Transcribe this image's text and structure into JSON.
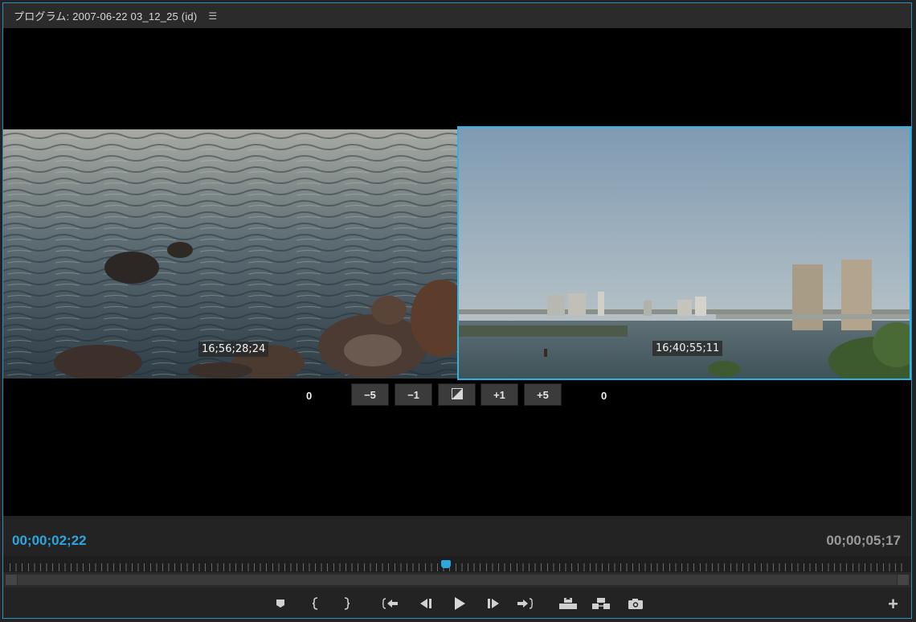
{
  "panel": {
    "title": "プログラム: 2007-06-22 03_12_25 (id)",
    "menu_icon": "hamburger-menu-icon"
  },
  "trim": {
    "left_clip_timecode": "16;56;28;24",
    "right_clip_timecode": "16;40;55;11",
    "left_offset": "0",
    "right_offset": "0",
    "buttons": [
      "−5",
      "−1",
      "",
      "+1",
      "+5"
    ],
    "center_icon": "trim-mode-icon"
  },
  "timebar": {
    "current_timecode": "00;00;02;22",
    "duration_timecode": "00;00;05;17"
  },
  "playhead_fraction": 0.487,
  "colors": {
    "accent": "#2aa6e0",
    "panel_border": "#2d8fc6",
    "selection": "#2fb1e6"
  },
  "transport": {
    "icons": [
      "add-marker-icon",
      "mark-in-icon",
      "mark-out-icon",
      "go-to-in-icon",
      "step-back-icon",
      "play-icon",
      "step-forward-icon",
      "go-to-out-icon",
      "lift-icon",
      "extract-icon",
      "export-frame-icon"
    ],
    "add_label": "+"
  }
}
